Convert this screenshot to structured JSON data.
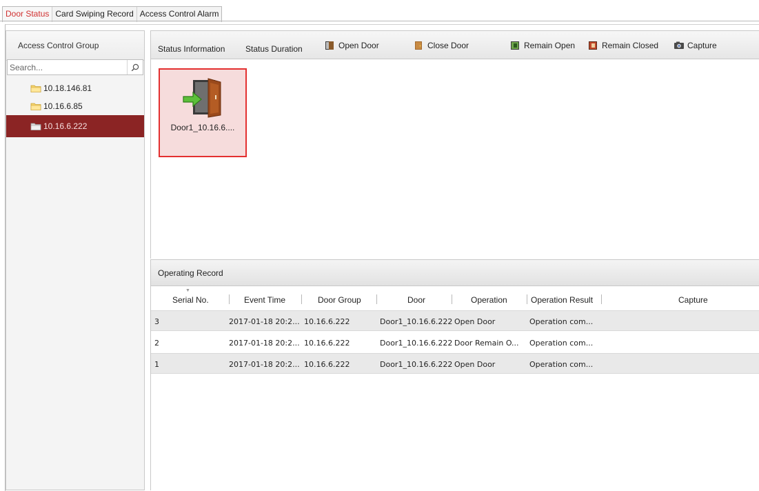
{
  "tabs": [
    {
      "label": "Door Status",
      "active": true
    },
    {
      "label": "Card Swiping Record",
      "active": false
    },
    {
      "label": "Access Control Alarm",
      "active": false
    }
  ],
  "left_panel": {
    "title": "Access Control Group",
    "search_placeholder": "Search...",
    "items": [
      {
        "label": "10.18.146.81",
        "selected": false
      },
      {
        "label": "10.16.6.85",
        "selected": false
      },
      {
        "label": "10.16.6.222",
        "selected": true
      }
    ]
  },
  "toolbar": {
    "status_information": "Status Information",
    "status_duration": "Status Duration",
    "open_door": "Open Door",
    "close_door": "Close Door",
    "remain_open": "Remain Open",
    "remain_closed": "Remain Closed",
    "capture": "Capture"
  },
  "doors": [
    {
      "label": "Door1_10.16.6....",
      "selected": true
    }
  ],
  "record": {
    "title": "Operating Record",
    "columns": [
      "Serial No.",
      "Event Time",
      "Door Group",
      "Door",
      "Operation",
      "Operation Result",
      "Capture"
    ],
    "rows": [
      {
        "serial": "3",
        "event_time": "2017-01-18 20:2...",
        "door_group": "10.16.6.222",
        "door": "Door1_10.16.6.222",
        "operation": "Open Door",
        "result": "Operation com..."
      },
      {
        "serial": "2",
        "event_time": "2017-01-18 20:2...",
        "door_group": "10.16.6.222",
        "door": "Door1_10.16.6.222",
        "operation": "Door Remain O...",
        "result": "Operation com..."
      },
      {
        "serial": "1",
        "event_time": "2017-01-18 20:2...",
        "door_group": "10.16.6.222",
        "door": "Door1_10.16.6.222",
        "operation": "Open Door",
        "result": "Operation com..."
      }
    ]
  },
  "colors": {
    "active_tab_text": "#d03030",
    "selected_tree_bg": "#8b2424",
    "door_card_border": "#e32f2f",
    "door_card_bg": "#f6dcdc"
  }
}
